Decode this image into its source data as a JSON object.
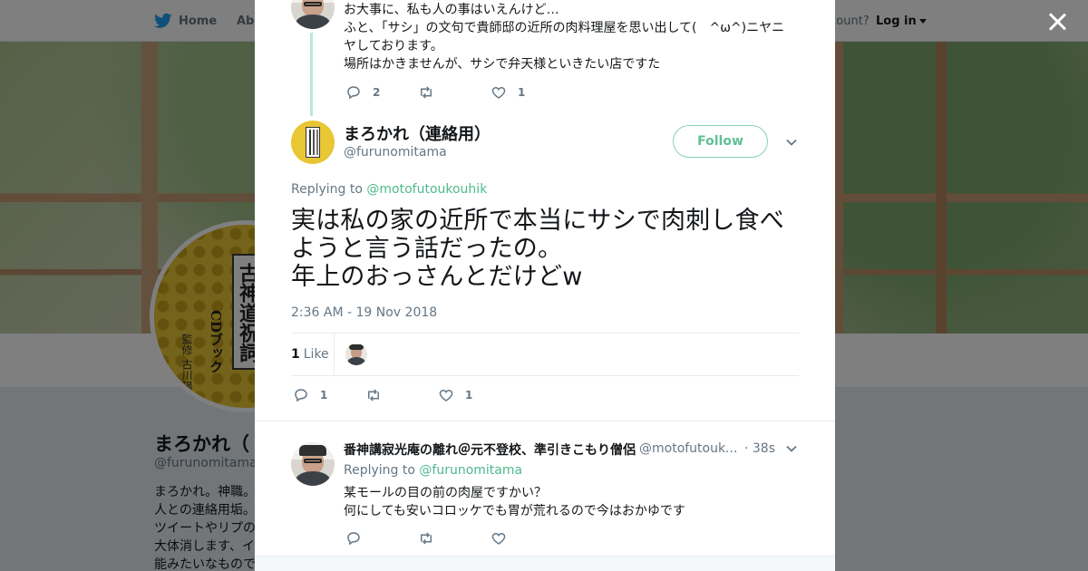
{
  "colors": {
    "accent": "#5fbf96",
    "link": "#4fb98f",
    "muted": "#657786",
    "text": "#14171a"
  },
  "background": {
    "nav": {
      "home": "Home",
      "about": "Abo",
      "account_prompt": "ccount?",
      "login": "Log in"
    },
    "profile": {
      "name": "まろかれ（",
      "handle": "@furunomitama",
      "bio_lines": [
        "まろかれ。神職。",
        "人との連絡用垢。",
        "ツイートやリプの",
        "大体消します、イ",
        "能みたいなもので"
      ],
      "avatar": {
        "title": "古神道祝詞",
        "sub": "CDブック",
        "author": "監修 古川陽明"
      }
    }
  },
  "close_label": "close",
  "modal": {
    "prev_tweet": {
      "lines": [
        "お大事に、私も人の事はいえんけど…",
        "ふと、「サシ」の文句で貴師邸の近所の肉料理屋を思い出して(　^ω^)ニヤニ",
        "ヤしております。",
        "場所はかきませんが、サシで弁天様といきたい店ですた"
      ],
      "replies": "2",
      "retweets": "",
      "likes": "1"
    },
    "main_tweet": {
      "name": "まろかれ（連絡用）",
      "handle": "@furunomitama",
      "follow_label": "Follow",
      "replying_prefix": "Replying to",
      "replying_to": "@motofutoukouhik",
      "text_lines": [
        "実は私の家の近所で本当にサシで肉刺し食べ",
        "ようと言う話だったの。",
        "年上のおっさんとだけどw"
      ],
      "timestamp": "2:36 AM - 19 Nov 2018",
      "like_count": "1",
      "like_label": "Like",
      "replies": "1",
      "retweets": "",
      "likes": "1"
    },
    "reply_tweet": {
      "name": "番神講寂光庵の離れ＠元不登校、準引きこもり僧侶",
      "handle": "@motofutoukouhik",
      "time": "· 38s",
      "replying_prefix": "Replying to",
      "replying_to": "@furunomitama",
      "lines": [
        "某モールの目の前の肉屋ですかい？",
        "何にしても安いコロッケでも胃が荒れるので今はおかゆです"
      ],
      "replies": "",
      "retweets": "",
      "likes": ""
    }
  },
  "icons": [
    "twitter-bird-icon",
    "close-icon",
    "reply-icon",
    "retweet-icon",
    "heart-icon",
    "chevron-down-icon"
  ]
}
